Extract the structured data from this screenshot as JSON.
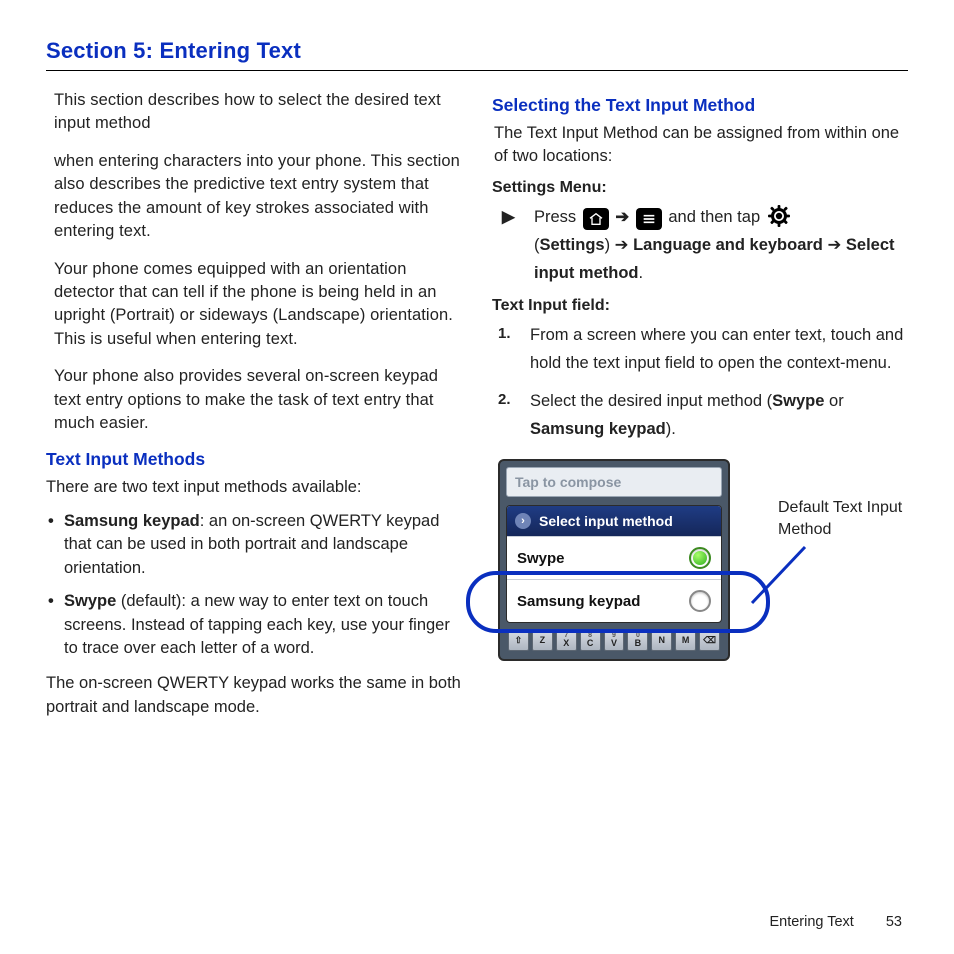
{
  "section_title": "Section 5: Entering Text",
  "intro": {
    "p1": "This section describes how to select the desired text input method",
    "p2": "when entering characters into your phone. This section also describes the predictive text entry system that reduces the amount of key strokes associated with entering text.",
    "p3": "Your phone comes equipped with an orientation detector that can tell if the phone is being held in an upright (Portrait) or sideways (Landscape) orientation. This is useful when entering text.",
    "p4": "Your phone also provides several on-screen keypad text entry options to make the task of text entry that much easier."
  },
  "methods": {
    "heading": "Text Input Methods",
    "lead": "There are two text input methods available:",
    "item1_bold": "Samsung keypad",
    "item1_rest": ": an on-screen QWERTY keypad that can be used in both portrait and landscape orientation.",
    "item2_bold": "Swype",
    "item2_rest": " (default): a new way to enter text on touch screens. Instead of tapping each key, use your finger to trace over each letter of a word.",
    "closing": "The on-screen QWERTY keypad works the same in both portrait and landscape mode."
  },
  "select": {
    "heading": "Selecting the Text Input Method",
    "lead": "The Text Input Method can be assigned from within one of two locations:",
    "settings_label": "Settings Menu:",
    "press": "Press ",
    "and_tap": " and then tap ",
    "arrow": "➔",
    "path_settings": "Settings",
    "path_rest1": " ➔ ",
    "path_lang": "Language and keyboard",
    "path_rest2": " ➔ ",
    "path_select": "Select input method",
    "period": ".",
    "textfield_label": "Text Input field:",
    "step1": "From a screen where you can enter text, touch and hold the text input field to open the context-menu.",
    "step2_pre": "Select the desired input method (",
    "step2_b1": "Swype",
    "step2_mid": " or ",
    "step2_b2": "Samsung keypad",
    "step2_post": ")."
  },
  "mock": {
    "compose_placeholder": "Tap to compose",
    "dialog_title": "Select input method",
    "opt1": "Swype",
    "opt2": "Samsung keypad",
    "callout": "Default Text Input Method",
    "keys": [
      "Z",
      "X",
      "C",
      "V",
      "B",
      "N",
      "M"
    ],
    "key_nums": [
      "",
      "7",
      "8",
      "9",
      "0",
      "",
      ""
    ]
  },
  "footer": {
    "title": "Entering Text",
    "page": "53"
  }
}
